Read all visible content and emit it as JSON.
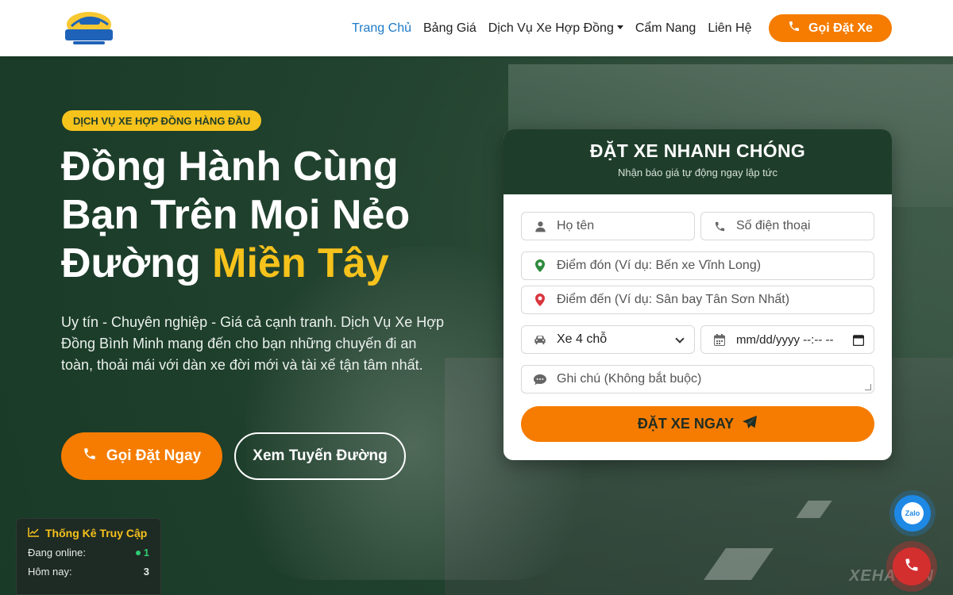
{
  "header": {
    "logo_text": "BÌNH MINH",
    "nav": [
      {
        "label": "Trang Chủ",
        "active": true
      },
      {
        "label": "Bảng Giá"
      },
      {
        "label": "Dịch Vụ Xe Hợp Đồng",
        "dropdown": true
      },
      {
        "label": "Cẩm Nang"
      },
      {
        "label": "Liên Hệ"
      }
    ],
    "call_button": "Gọi Đặt Xe"
  },
  "hero": {
    "badge": "DỊCH VỤ XE HỢP ĐỒNG HÀNG ĐẦU",
    "title_line1": "Đồng Hành Cùng",
    "title_line2": "Bạn Trên Mọi Nẻo",
    "title_line3_plain": "Đường ",
    "title_line3_highlight": "Miền Tây",
    "description": "Uy tín - Chuyên nghiệp - Giá cả cạnh tranh. Dịch Vụ Xe Hợp Đồng Bình Minh mang đến cho bạn những chuyến đi an toàn, thoải mái với dàn xe đời mới và tài xế tận tâm nhất.",
    "primary_button": "Gọi Đặt Ngay",
    "secondary_button": "Xem Tuyến Đường",
    "watermark": "XEHAY.VN"
  },
  "booking": {
    "title": "ĐẶT XE NHANH CHÓNG",
    "subtitle": "Nhận báo giá tự động ngay lập tức",
    "name_placeholder": "Họ tên",
    "phone_placeholder": "Số điện thoại",
    "pickup_placeholder": "Điểm đón (Ví dụ: Bến xe Vĩnh Long)",
    "dropoff_placeholder": "Điểm đến (Ví dụ: Sân bay Tân Sơn Nhất)",
    "vehicle_selected": "Xe 4 chỗ",
    "datetime_placeholder": "mm/dd/yyyy --:-- --",
    "note_placeholder": "Ghi chú (Không bắt buộc)",
    "submit": "ĐẶT XE NGAY"
  },
  "stats": {
    "title": "Thống Kê Truy Cập",
    "online_label": "Đang online:",
    "online_value": "1",
    "today_label": "Hôm nay:",
    "today_value": "3"
  },
  "floating": {
    "zalo_label": "Zalo"
  },
  "colors": {
    "accent": "#f57c00",
    "highlight": "#f6c21c",
    "brand_dark": "#1f3d2b",
    "nav_active": "#1e7ac7"
  }
}
